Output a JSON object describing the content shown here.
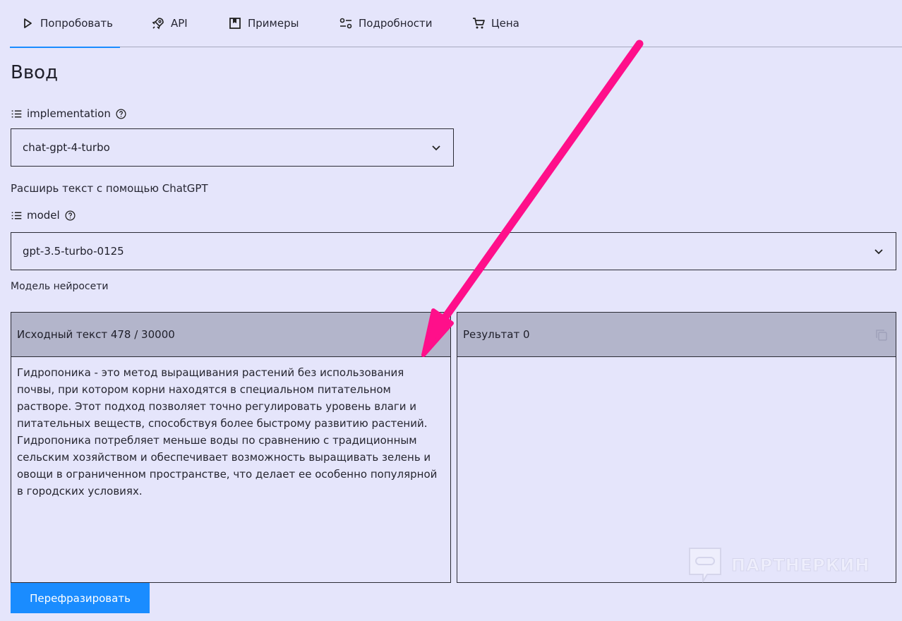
{
  "tabs": [
    {
      "label": "Попробовать",
      "icon": "play-icon"
    },
    {
      "label": "API",
      "icon": "rocket-icon"
    },
    {
      "label": "Примеры",
      "icon": "bookmark-icon"
    },
    {
      "label": "Подробности",
      "icon": "settings-sliders-icon"
    },
    {
      "label": "Цена",
      "icon": "cart-icon"
    }
  ],
  "page": {
    "title": "Ввод"
  },
  "implementation": {
    "label": "implementation",
    "value": "chat-gpt-4-turbo",
    "hint": "Расширь текст с помощью ChatGPT"
  },
  "model": {
    "label": "model",
    "value": "gpt-3.5-turbo-0125",
    "hint": "Модель нейросети"
  },
  "source": {
    "header": "Исходный текст 478 / 30000",
    "text": "Гидропоника - это метод выращивания растений без использования почвы, при котором корни находятся в специальном питательном растворе. Этот подход позволяет точно регулировать уровень влаги и питательных веществ, способствуя более быстрому развитию растений. Гидропоника потребляет меньше воды по сравнению с традиционным сельским хозяйством и обеспечивает возможность выращивать зелень и овощи в ограниченном пространстве, что делает ее особенно популярной в городских условиях."
  },
  "result": {
    "header": "Результат 0",
    "text": ""
  },
  "actions": {
    "submit_label": "Перефразировать"
  },
  "watermark": {
    "text": "ПАРТНЕРКИН"
  },
  "colors": {
    "accent": "#1a8cff",
    "annotation_arrow": "#ff0f8a",
    "panel_header": "#b3b5cb",
    "background": "#e5e5fb"
  }
}
